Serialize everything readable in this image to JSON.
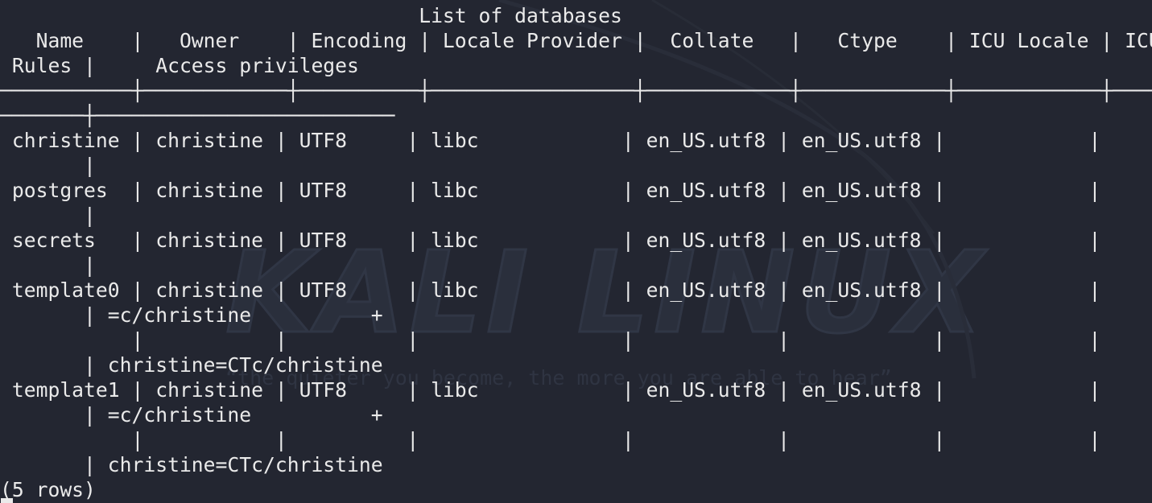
{
  "watermark": {
    "title": "KALI LINUX",
    "tagline": "“the quieter you become, the more you are able to hear”"
  },
  "terminal": {
    "lines": [
      "                                   List of databases",
      "   Name    |   Owner    | Encoding | Locale Provider |  Collate   |   Ctype    | ICU Locale | ICU",
      " Rules |     Access privileges",
      "───────────┼────────────┼──────────┼─────────────────┼────────────┼────────────┼────────────┼────",
      "───────┼─────────────────────────",
      " christine | christine | UTF8     | libc            | en_US.utf8 | en_US.utf8 |            |",
      "       |",
      " postgres  | christine | UTF8     | libc            | en_US.utf8 | en_US.utf8 |            |",
      "       |",
      " secrets   | christine | UTF8     | libc            | en_US.utf8 | en_US.utf8 |            |",
      "       |",
      " template0 | christine | UTF8     | libc            | en_US.utf8 | en_US.utf8 |            |",
      "       | =c/christine          +",
      "           |           |          |                 |            |            |            |",
      "       | christine=CTc/christine",
      " template1 | christine | UTF8     | libc            | en_US.utf8 | en_US.utf8 |            |",
      "       | =c/christine          +",
      "           |           |          |                 |            |            |            |",
      "       | christine=CTc/christine",
      "(5 rows)"
    ]
  }
}
